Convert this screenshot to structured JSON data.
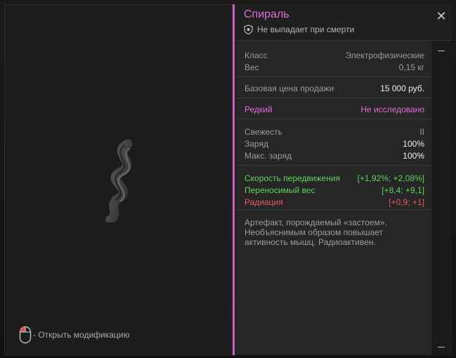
{
  "hint": {
    "text": "- Открыть модификацию"
  },
  "item": {
    "name": "Спираль",
    "drop_status": "Не выпадает при смерти"
  },
  "stats": {
    "class_label": "Класс",
    "class_value": "Электрофизические",
    "weight_label": "Вес",
    "weight_value": "0,15 кг",
    "price_label": "Базовая цена продажи",
    "price_value": "15 000 руб.",
    "rarity_label": "Редкий",
    "research_value": "Не исследовано",
    "freshness_label": "Свежесть",
    "freshness_value": "II",
    "charge_label": "Заряд",
    "charge_value": "100%",
    "max_charge_label": "Макс. заряд",
    "max_charge_value": "100%"
  },
  "effects": [
    {
      "label": "Скорость передвижения",
      "value": "[+1,92%; +2,08%]"
    },
    {
      "label": "Переносимый вес",
      "value": "[+8,4; +9,1]"
    },
    {
      "label": "Радиация",
      "value": "[+0,9; +1]"
    }
  ],
  "description": "Артефакт, порождаемый «застоем». Необъяснимым образом повышает активность мышц. Радиоактивен.",
  "colors": {
    "accent": "#de6fd8",
    "positive": "#5fd35a",
    "negative": "#e15b5b"
  },
  "icons": {
    "close": "close-icon",
    "shield": "shield-icon",
    "mouse": "mouse-icon",
    "artifact": "spiral-artifact-image"
  }
}
